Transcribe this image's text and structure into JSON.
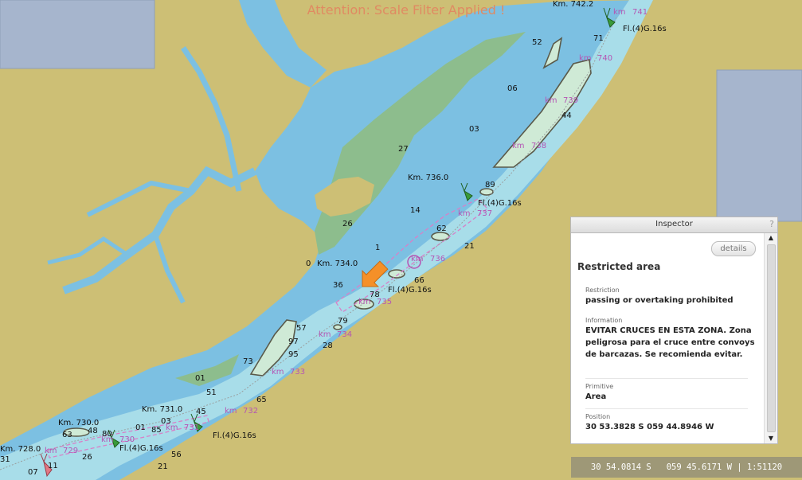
{
  "banner": {
    "text": "Attention: Scale Filter Applied !",
    "color": "#e08a62"
  },
  "colors": {
    "land": "#cdbf75",
    "shallow_water": "#7cc0e2",
    "channel_water": "#a8dde9",
    "intertidal": "#8dbd8d",
    "pale_shoal": "#cfead6",
    "deep_panel": "#a6b5cd",
    "symbol_magenta": "#b455b4",
    "buoy_green": "#3a9a3a",
    "arrow_orange": "#f59028"
  },
  "map_labels": {
    "km_points": [
      "Km. 742.2",
      "Km. 736.0",
      "Km. 734.0",
      "Km. 731.0",
      "Km. 730.0",
      "Km. 728.0"
    ],
    "km_marks": [
      "741",
      "740",
      "739",
      "738",
      "737",
      "736",
      "735",
      "734",
      "733",
      "732",
      "731",
      "730",
      "729"
    ],
    "km_prefix": "km",
    "light_characteristic": "Fl.(4)G.16s",
    "depths": [
      "52",
      "71",
      "06",
      "03",
      "27",
      "14",
      "26",
      "1",
      "0",
      "36",
      "44",
      "89",
      "62",
      "21",
      "66",
      "78",
      "57",
      "79",
      "28",
      "97",
      "95",
      "73",
      "65",
      "01",
      "51",
      "03",
      "01",
      "85",
      "45",
      "63",
      "80",
      "48",
      "26",
      "56",
      "11",
      "21",
      "07",
      "31"
    ]
  },
  "inspector": {
    "title": "Inspector",
    "help": "?",
    "details_label": "details",
    "heading": "Restricted area",
    "fields": [
      {
        "label": "Restriction",
        "value": "passing or overtaking prohibited"
      },
      {
        "label": "Information",
        "value": "EVITAR CRUCES EN ESTA ZONA. Zona peligrosa para el cruce entre convoys de barcazas. Se recomienda evitar."
      },
      {
        "label": "Primitive",
        "value": "Area"
      },
      {
        "label": "Position",
        "value": "30 53.3828 S  059 44.8946 W"
      }
    ],
    "scroll_up_icon": "▲",
    "scroll_down_icon": "▼"
  },
  "status": {
    "text": "30 54.0814 S   059 45.6171 W | 1:51120",
    "latitude": "30 54.0814 S",
    "longitude": "059 45.6171 W",
    "scale": "1:51120"
  }
}
